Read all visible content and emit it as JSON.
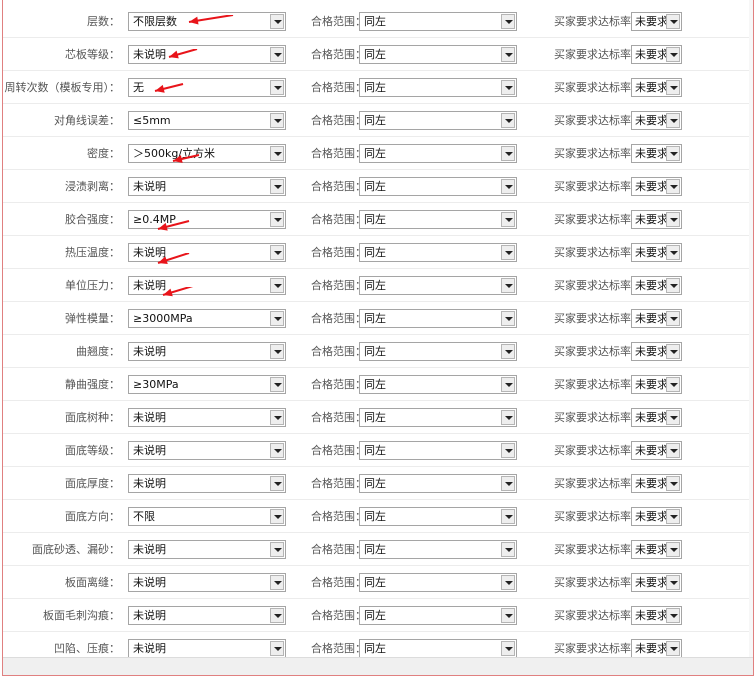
{
  "colors": {
    "annotation_red": "#e8141a",
    "border_red": "#e08080"
  },
  "labels": {
    "range": "合格范围：",
    "buyer": "买家要求达标率："
  },
  "rows": [
    {
      "name": "层数：",
      "value": "不限层数",
      "range": "同左",
      "buyer": "未要求"
    },
    {
      "name": "芯板等级：",
      "value": "未说明",
      "range": "同左",
      "buyer": "未要求"
    },
    {
      "name": "周转次数（模板专用）：",
      "value": "无",
      "range": "同左",
      "buyer": "未要求"
    },
    {
      "name": "对角线误差：",
      "value": "≤5mm",
      "range": "同左",
      "buyer": "未要求"
    },
    {
      "name": "密度：",
      "value": "＞500kg/立方米",
      "range": "同左",
      "buyer": "未要求"
    },
    {
      "name": "浸渍剥离：",
      "value": "未说明",
      "range": "同左",
      "buyer": "未要求"
    },
    {
      "name": "胶合强度：",
      "value": "≥0.4MP",
      "range": "同左",
      "buyer": "未要求"
    },
    {
      "name": "热压温度：",
      "value": "未说明",
      "range": "同左",
      "buyer": "未要求"
    },
    {
      "name": "单位压力：",
      "value": "未说明",
      "range": "同左",
      "buyer": "未要求"
    },
    {
      "name": "弹性模量：",
      "value": "≥3000MPa",
      "range": "同左",
      "buyer": "未要求"
    },
    {
      "name": "曲翘度：",
      "value": "未说明",
      "range": "同左",
      "buyer": "未要求"
    },
    {
      "name": "静曲强度：",
      "value": "≥30MPa",
      "range": "同左",
      "buyer": "未要求"
    },
    {
      "name": "面底树种：",
      "value": "未说明",
      "range": "同左",
      "buyer": "未要求"
    },
    {
      "name": "面底等级：",
      "value": "未说明",
      "range": "同左",
      "buyer": "未要求"
    },
    {
      "name": "面底厚度：",
      "value": "未说明",
      "range": "同左",
      "buyer": "未要求"
    },
    {
      "name": "面底方向：",
      "value": "不限",
      "range": "同左",
      "buyer": "未要求"
    },
    {
      "name": "面底砂透、漏砂：",
      "value": "未说明",
      "range": "同左",
      "buyer": "未要求"
    },
    {
      "name": "板面离缝：",
      "value": "未说明",
      "range": "同左",
      "buyer": "未要求"
    },
    {
      "name": "板面毛刺沟痕：",
      "value": "未说明",
      "range": "同左",
      "buyer": "未要求"
    },
    {
      "name": "凹陷、压痕：",
      "value": "未说明",
      "range": "同左",
      "buyer": "未要求"
    }
  ]
}
